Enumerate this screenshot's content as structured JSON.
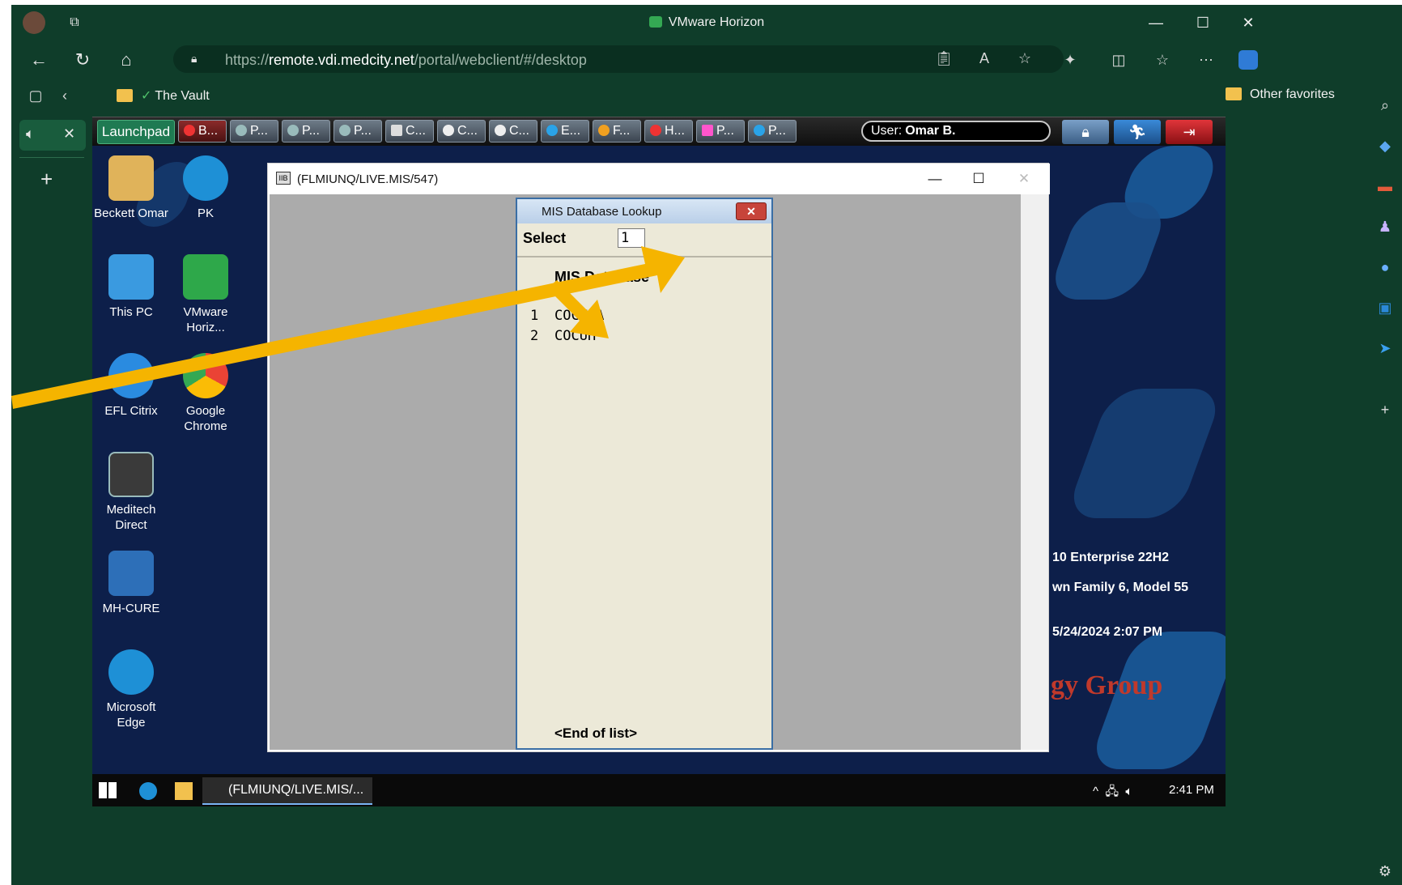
{
  "browser": {
    "window_title": "VMware Horizon",
    "url_domain": "remote.vdi.medcity.net",
    "url_path": "/portal/webclient/#/desktop",
    "favorites": {
      "vault": "The Vault",
      "other": "Other favorites"
    }
  },
  "horizon_toolbar": {
    "launchpad": "Launchpad",
    "tabs": [
      "B...",
      "P...",
      "P...",
      "P...",
      "C...",
      "C...",
      "C...",
      "E...",
      "F...",
      "H...",
      "P...",
      "P..."
    ],
    "user_label": "User:",
    "user_name": "Omar B."
  },
  "desktop": {
    "icons": {
      "beckett": "Beckett Omar",
      "pk": "PK",
      "thispc": "This PC",
      "vmware": "VMware Horiz...",
      "eflcitrix": "EFL Citrix",
      "chrome": "Google Chrome",
      "meditech": "Meditech Direct",
      "mhcure": "MH-CURE",
      "edge": "Microsoft Edge"
    },
    "sysinfo": [
      "10 Enterprise 22H2",
      "wn Family 6, Model 55",
      "5/24/2024 2:07 PM"
    ],
    "brand": "gy Group"
  },
  "app_window": {
    "title": "(FLMIUNQ/LIVE.MIS/547)",
    "icon_text": "IIB"
  },
  "dialog": {
    "title": "MIS Database Lookup",
    "close_label": "✕",
    "select_label": "Select",
    "select_value": "1",
    "list_header": "MIS Database",
    "items": [
      {
        "num": "1",
        "name": "COCMIA"
      },
      {
        "num": "2",
        "name": "COCUH"
      }
    ],
    "end_of_list": "<End of list>"
  },
  "taskbar": {
    "active_app": "(FLMIUNQ/LIVE.MIS/...",
    "time": "2:41 PM"
  },
  "colors": {
    "browser_chrome": "#0f3d2a",
    "annotation_arrow": "#f5b400",
    "dialog_bg": "#ece9d8",
    "app_body_bg": "#ababab"
  }
}
